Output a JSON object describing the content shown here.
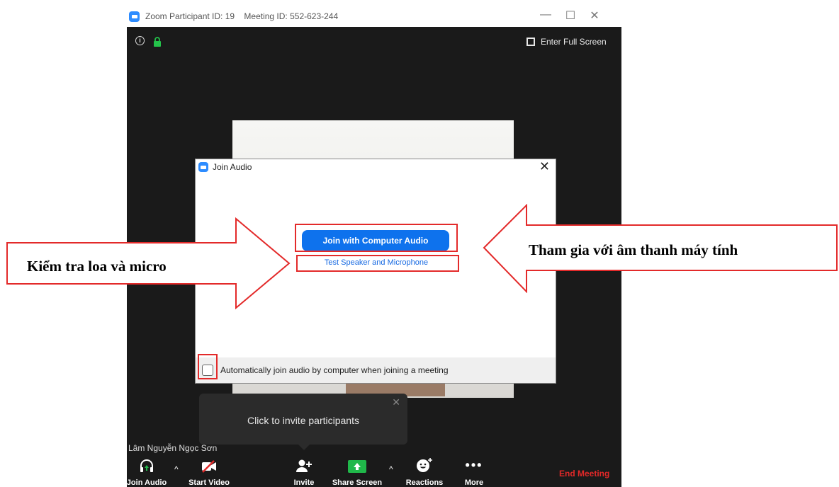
{
  "window": {
    "title_participant": "Zoom Participant ID: 19",
    "title_meeting": "Meeting ID: 552-623-244",
    "full_screen_label": "Enter Full Screen"
  },
  "participant_name": "Lâm Nguyễn Ngọc Sơn",
  "toolbar": {
    "join_audio": "Join Audio",
    "start_video": "Start Video",
    "invite": "Invite",
    "share_screen": "Share Screen",
    "reactions": "Reactions",
    "more": "More",
    "end_meeting": "End Meeting"
  },
  "tooltip": {
    "text": "Click to invite participants"
  },
  "dialog": {
    "title": "Join Audio",
    "join_button": "Join with Computer Audio",
    "test_link": "Test Speaker and Microphone",
    "auto_join_label": "Automatically join audio by computer when joining a meeting"
  },
  "annotations": {
    "left": "Kiểm tra loa và micro",
    "right": "Tham gia với âm thanh máy tính"
  },
  "colors": {
    "accent": "#0e72ed",
    "highlight": "#e32a2a",
    "end_meeting": "#e02828",
    "share_green": "#20b84a"
  }
}
